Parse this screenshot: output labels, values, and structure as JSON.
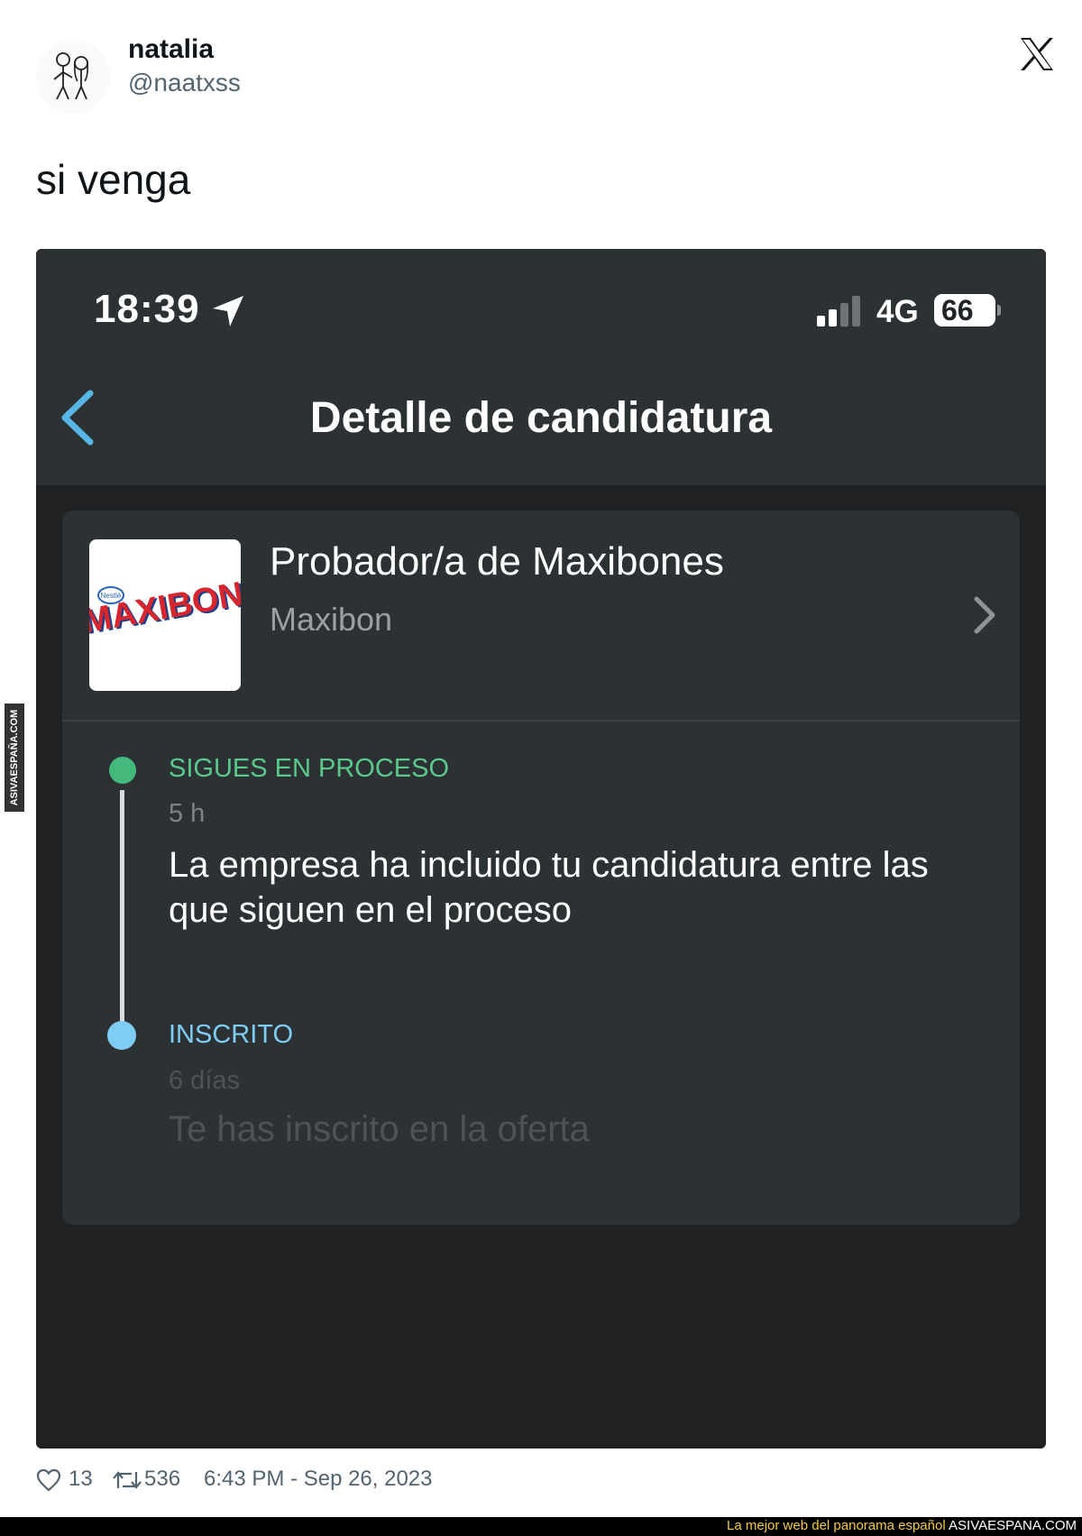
{
  "tweet": {
    "user_name": "natalia",
    "user_handle": "@naatxss",
    "text": "si venga",
    "likes": "13",
    "retweets": "536",
    "timestamp": "6:43 PM - Sep 26, 2023"
  },
  "icons": {
    "platform": "x-logo-icon",
    "like": "heart-icon",
    "retweet": "retweet-icon",
    "back": "chevron-left-icon",
    "chevron": "chevron-right-icon",
    "location": "location-arrow-icon",
    "signal": "signal-bars-icon"
  },
  "phone": {
    "status_bar": {
      "time": "18:39",
      "network": "4G",
      "battery": "66",
      "signal_bars_filled": 2,
      "signal_bars_total": 4
    },
    "nav": {
      "title": "Detalle de candidatura"
    },
    "job": {
      "title": "Probador/a de Maxibones",
      "company": "Maxibon",
      "logo_text": "MAXIBON",
      "logo_badge": "Nestlé"
    },
    "timeline": [
      {
        "status": "SIGUES EN PROCESO",
        "time": "5 h",
        "description": "La empresa ha incluido tu candidatura entre las que siguen en el proceso",
        "color": "#45b97c"
      },
      {
        "status": "INSCRITO",
        "time": "6 días",
        "description": "Te has inscrito en la oferta",
        "color": "#7fcdf3"
      }
    ]
  },
  "watermark": {
    "tagline": "La mejor web del panorama español",
    "brand": "ASIVAESPANA.COM",
    "side": "ASIVAESPAÑA.COM"
  },
  "colors": {
    "screen_bg": "#202122",
    "card_bg": "#2c3134",
    "accent_blue": "#58b6e6",
    "status_green": "#45b97c"
  }
}
